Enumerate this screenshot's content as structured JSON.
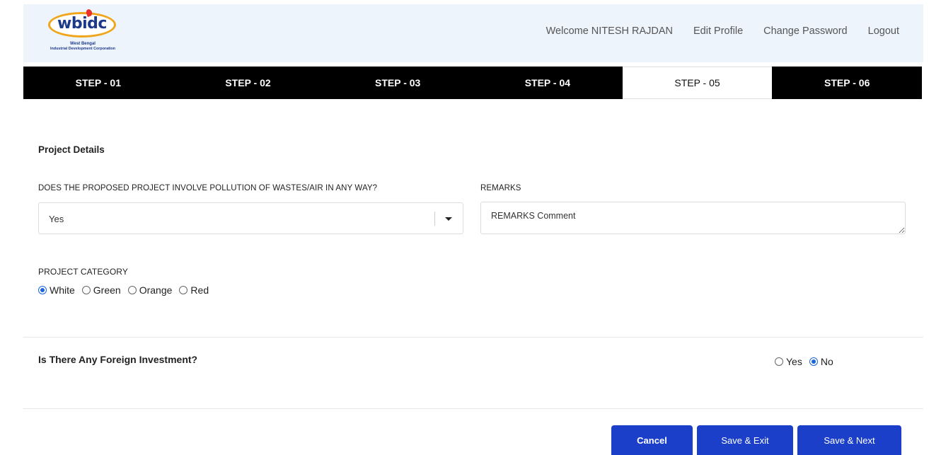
{
  "brand": {
    "logo_text": "wbidc",
    "logo_line1": "West Bengal",
    "logo_line2": "Industrial Development Corporation"
  },
  "topnav": {
    "welcome": "Welcome NITESH RAJDAN",
    "edit_profile": "Edit Profile",
    "change_password": "Change Password",
    "logout": "Logout"
  },
  "steps": [
    {
      "label": "STEP - 01"
    },
    {
      "label": "STEP - 02"
    },
    {
      "label": "STEP - 03"
    },
    {
      "label": "STEP - 04"
    },
    {
      "label": "STEP - 05",
      "active": true
    },
    {
      "label": "STEP - 06"
    }
  ],
  "section": {
    "title": "Project Details",
    "pollution_label": "DOES THE PROPOSED PROJECT INVOLVE POLLUTION OF WASTES/AIR IN ANY WAY?",
    "pollution_value": "Yes",
    "remarks_label": "REMARKS",
    "remarks_value": "REMARKS Comment",
    "category_label": "PROJECT CATEGORY",
    "category_options": [
      "White",
      "Green",
      "Orange",
      "Red"
    ],
    "category_selected": "White"
  },
  "foreign": {
    "question": "Is There Any Foreign Investment?",
    "options": [
      "Yes",
      "No"
    ],
    "selected": "No"
  },
  "buttons": {
    "cancel": "Cancel",
    "save_exit": "Save & Exit",
    "save_next": "Save & Next"
  },
  "colors": {
    "header_bg": "#eef4fc",
    "steps_bg": "#000000",
    "primary": "#1b3fc9",
    "radio_checked": "#1a66d8"
  }
}
